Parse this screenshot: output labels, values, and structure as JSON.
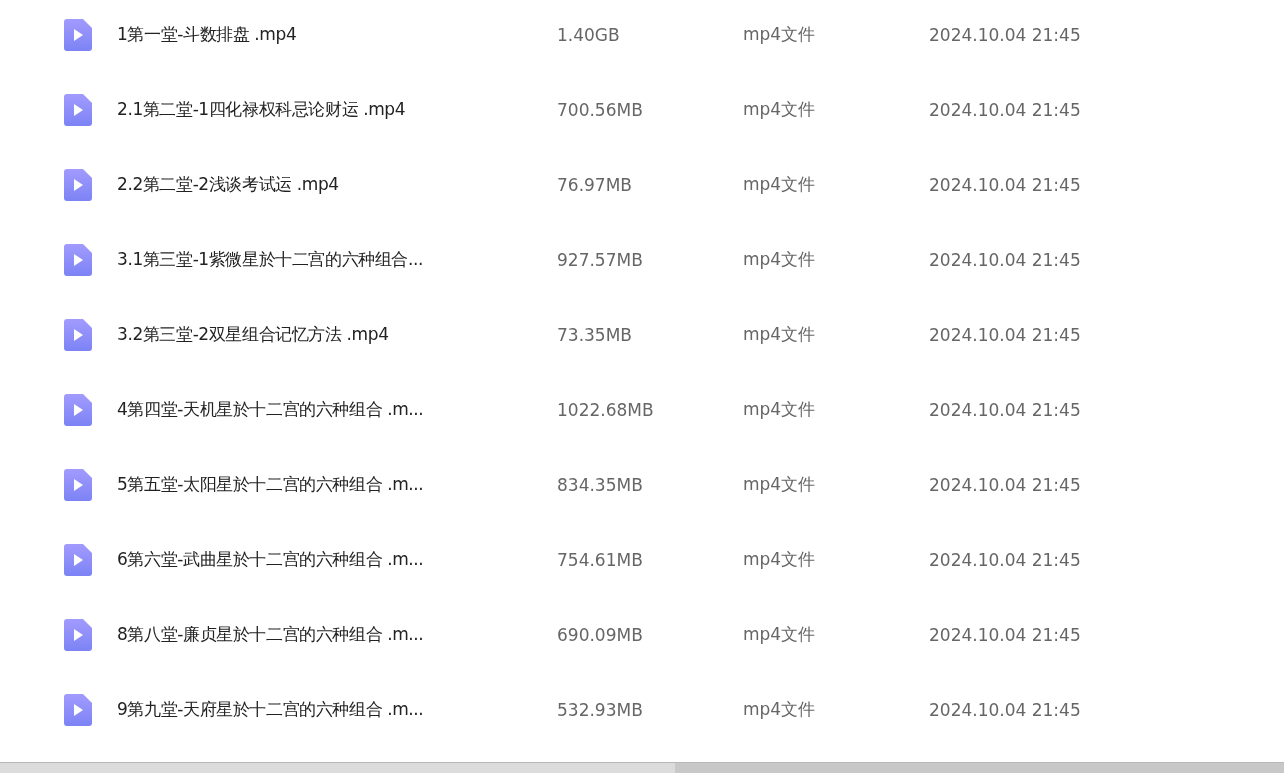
{
  "files": [
    {
      "name": "1第一堂-斗数排盘 .mp4",
      "size": "1.40GB",
      "type": "mp4文件",
      "modified": "2024.10.04 21:45"
    },
    {
      "name": "2.1第二堂-1四化禄权科忌论财运 .mp4",
      "size": "700.56MB",
      "type": "mp4文件",
      "modified": "2024.10.04 21:45"
    },
    {
      "name": "2.2第二堂-2浅谈考试运 .mp4",
      "size": "76.97MB",
      "type": "mp4文件",
      "modified": "2024.10.04 21:45"
    },
    {
      "name": "3.1第三堂-1紫微星於十二宫的六种组合...",
      "size": "927.57MB",
      "type": "mp4文件",
      "modified": "2024.10.04 21:45"
    },
    {
      "name": "3.2第三堂-2双星组合记忆方法 .mp4",
      "size": "73.35MB",
      "type": "mp4文件",
      "modified": "2024.10.04 21:45"
    },
    {
      "name": "4第四堂-天机星於十二宫的六种组合 .m...",
      "size": "1022.68MB",
      "type": "mp4文件",
      "modified": "2024.10.04 21:45"
    },
    {
      "name": "5第五堂-太阳星於十二宫的六种组合 .m...",
      "size": "834.35MB",
      "type": "mp4文件",
      "modified": "2024.10.04 21:45"
    },
    {
      "name": "6第六堂-武曲星於十二宫的六种组合 .m...",
      "size": "754.61MB",
      "type": "mp4文件",
      "modified": "2024.10.04 21:45"
    },
    {
      "name": "8第八堂-廉贞星於十二宫的六种组合 .m...",
      "size": "690.09MB",
      "type": "mp4文件",
      "modified": "2024.10.04 21:45"
    },
    {
      "name": "9第九堂-天府星於十二宫的六种组合 .m...",
      "size": "532.93MB",
      "type": "mp4文件",
      "modified": "2024.10.04 21:45"
    }
  ]
}
